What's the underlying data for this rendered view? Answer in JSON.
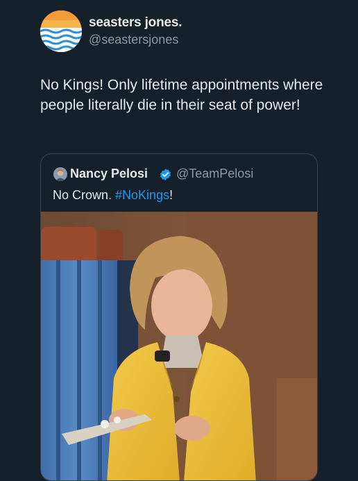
{
  "tweet": {
    "display_name": "seasters jones.",
    "handle": "@seastersjones",
    "text": "No Kings! Only lifetime appointments where people literally die in their seat of power!",
    "avatar_icon": "sunset-waves-avatar"
  },
  "quote": {
    "display_name": "Nancy Pelosi",
    "handle": "@TeamPelosi",
    "text_before": "No Crown. ",
    "hashtag": "#NoKings",
    "text_after": "!",
    "verified_icon": "verified-badge-icon",
    "media_icon": "video-still"
  },
  "colors": {
    "background": "#15202b",
    "text": "#e7e9ea",
    "secondary_text": "#8b98a5",
    "link": "#1d9bf0",
    "verified": "#1d9bf0"
  }
}
